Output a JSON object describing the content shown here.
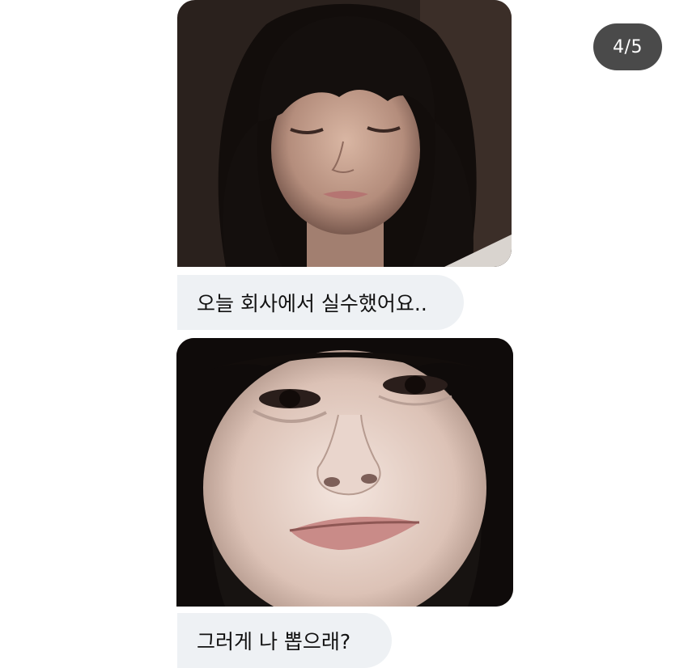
{
  "pagination": {
    "label": "4/5"
  },
  "chat": {
    "messages": [
      {
        "type": "image",
        "description_icon": "photo-sad-face"
      },
      {
        "type": "text",
        "text": "오늘 회사에서 실수했어요.."
      },
      {
        "type": "image",
        "description_icon": "photo-smiling-face"
      },
      {
        "type": "text",
        "text": "그러게 나 뽑으래?"
      }
    ]
  },
  "colors": {
    "bubble_background": "#eef1f4",
    "counter_background": "#4a4a4a",
    "text": "#111111"
  }
}
